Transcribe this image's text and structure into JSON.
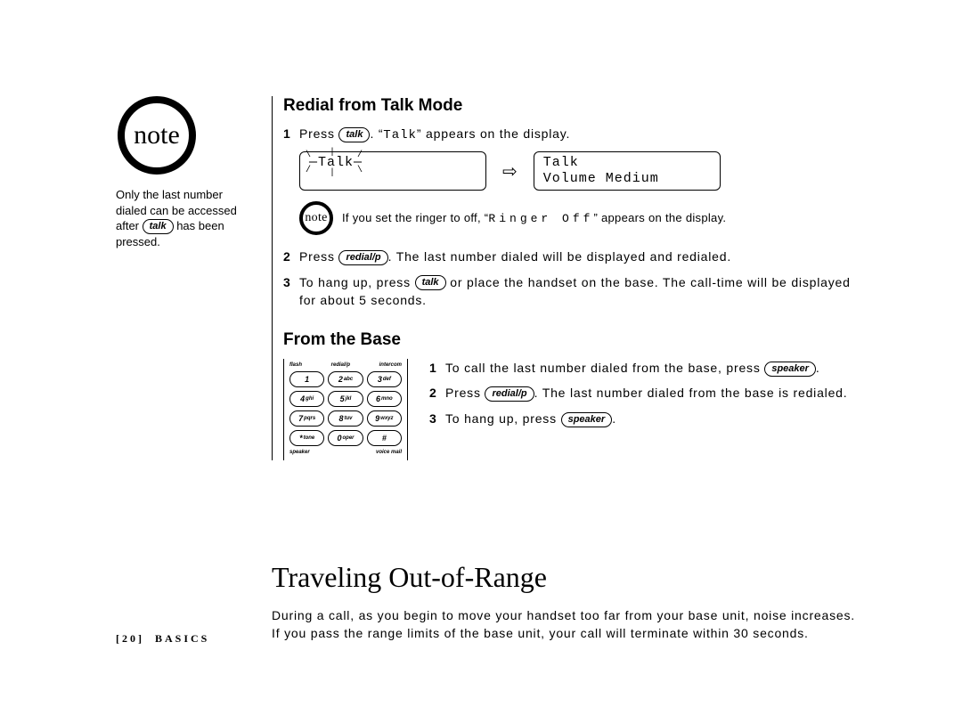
{
  "sidebar": {
    "note_label": "note",
    "text_before": "Only the last number dialed can be accessed after ",
    "pill": "talk",
    "text_after": " has been pressed."
  },
  "section1": {
    "heading": "Redial from Talk Mode",
    "step1": {
      "num": "1",
      "t1": "Press ",
      "pill": "talk",
      "t2": ". “",
      "mono": "Talk",
      "t3": "” appears on the display."
    },
    "lcd_left_line1_pre": "—",
    "lcd_left_line1_mid": "Talk",
    "lcd_left_line1_post": "—",
    "lcd_right_line1": "Talk",
    "lcd_right_line2": "Volume Medium",
    "arrow": "⇨",
    "inline_note": {
      "label": "note",
      "t1": "If you set the ringer to off, “",
      "mono": "Ringer Off",
      "t2": "” appears on the display."
    },
    "step2": {
      "num": "2",
      "t1": "Press ",
      "pill": "redial/p",
      "t2": ". The last number dialed will be displayed and redialed."
    },
    "step3": {
      "num": "3",
      "t1": "To hang up, press ",
      "pill": "talk",
      "t2": " or place the handset on the base. The call-time will be displayed for about 5 seconds."
    }
  },
  "section2": {
    "heading": "From the Base",
    "keypad_top": [
      "flash",
      "redial/p",
      "intercom"
    ],
    "keypad": [
      {
        "main": "1",
        "sub": ""
      },
      {
        "main": "2",
        "sub": "abc"
      },
      {
        "main": "3",
        "sub": "def"
      },
      {
        "main": "4",
        "sub": "ghi"
      },
      {
        "main": "5",
        "sub": "jkl"
      },
      {
        "main": "6",
        "sub": "mno"
      },
      {
        "main": "7",
        "sub": "pqrs"
      },
      {
        "main": "8",
        "sub": "tuv"
      },
      {
        "main": "9",
        "sub": "wxyz"
      },
      {
        "main": "*",
        "sub": "tone"
      },
      {
        "main": "0",
        "sub": "oper"
      },
      {
        "main": "#",
        "sub": ""
      }
    ],
    "keypad_bottom": [
      "speaker",
      "voice mail"
    ],
    "step1": {
      "num": "1",
      "t1": "To call the last number dialed from the base, press ",
      "pill": "speaker",
      "t2": "."
    },
    "step2": {
      "num": "2",
      "t1": "Press ",
      "pill": "redial/p",
      "t2": ". The last number dialed from the base is redialed."
    },
    "step3": {
      "num": "3",
      "t1": "To hang up, press ",
      "pill": "speaker",
      "t2": "."
    }
  },
  "section3": {
    "heading": "Traveling Out-of-Range",
    "body": "During a call, as you begin to move your handset too far from your base unit, noise increases. If you pass the range limits of the base unit, your call will terminate within 30 seconds."
  },
  "footer": {
    "page": "[20]",
    "label": "BASICS"
  }
}
